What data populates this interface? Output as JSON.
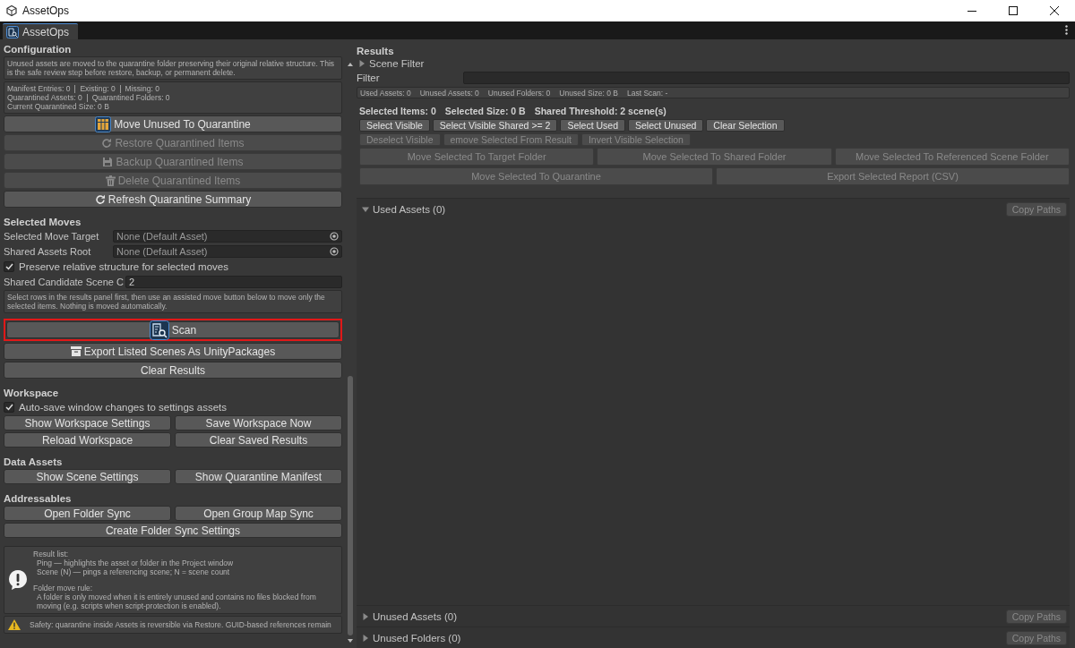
{
  "window": {
    "title": "AssetOps"
  },
  "tabs": [
    {
      "label": "AssetOps",
      "selected": true
    }
  ],
  "configuration": {
    "heading": "Configuration",
    "help": "Unused assets are moved to the quarantine folder preserving their original relative structure. This is the safe review step before restore, backup, or permanent delete.",
    "stats": [
      [
        "Manifest Entries: 0",
        "Existing: 0",
        "Missing: 0"
      ],
      [
        "Quarantined Assets: 0",
        "Quarantined Folders: 0"
      ],
      [
        "Current Quarantined Size: 0 B"
      ]
    ],
    "buttons": [
      {
        "label": "Move Unused To Quarantine",
        "disabled": false
      },
      {
        "label": "Restore Quarantined Items",
        "disabled": true
      },
      {
        "label": "Backup Quarantined Items",
        "disabled": true
      },
      {
        "label": "Delete Quarantined Items",
        "disabled": true
      },
      {
        "label": "Refresh Quarantine Summary",
        "disabled": false
      }
    ]
  },
  "selected_moves": {
    "heading": "Selected Moves",
    "fields": [
      {
        "kind": "object",
        "label": "Selected Move Target",
        "value": "None (Default Asset)"
      },
      {
        "kind": "object",
        "label": "Shared Assets Root",
        "value": "None (Default Asset)"
      },
      {
        "kind": "checkbox",
        "label": "Preserve relative structure for selected moves",
        "checked": true
      },
      {
        "kind": "text",
        "label": "Shared Candidate Scene C",
        "value": "2"
      }
    ],
    "help": "Select rows in the results panel first, then use an assisted move button below to move only the selected items. Nothing is moved automatically.",
    "buttons": [
      {
        "label": "Scan",
        "highlighted": true
      },
      {
        "label": "Export Listed Scenes As UnityPackages",
        "highlighted": false
      },
      {
        "label": "Clear Results",
        "highlighted": false
      }
    ]
  },
  "workspace": {
    "heading": "Workspace",
    "checkbox": {
      "label": "Auto-save window changes to settings assets",
      "checked": true
    },
    "button_rows": [
      [
        "Show Workspace Settings",
        "Save Workspace Now"
      ],
      [
        "Reload Workspace",
        "Clear Saved Results"
      ]
    ]
  },
  "data_assets": {
    "heading": "Data Assets",
    "button_rows": [
      [
        "Show Scene Settings",
        "Show Quarantine Manifest"
      ]
    ]
  },
  "addressables": {
    "heading": "Addressables",
    "button_rows": [
      [
        "Open Folder Sync",
        "Open Group Map Sync"
      ],
      [
        "Create Folder Sync Settings"
      ]
    ]
  },
  "info_box": {
    "paragraphs": [
      {
        "title": "Result list:",
        "lines": [
          "Ping — highlights the asset or folder in the Project window",
          "Scene (N) — pings a referencing scene; N = scene count"
        ]
      },
      {
        "title": "Folder move rule:",
        "lines": [
          "A folder is only moved when it is entirely unused and contains no files blocked from moving (e.g. scripts when script-protection is enabled)."
        ]
      }
    ]
  },
  "warning_box": {
    "text": "Safety: quarantine inside Assets is reversible via Restore. GUID-based references remain"
  },
  "results": {
    "heading": "Results",
    "scene_filter": {
      "label": "Scene Filter",
      "expanded": false
    },
    "filter": {
      "label": "Filter"
    },
    "stats": [
      "Used Assets: 0",
      "Unused Assets: 0",
      "Unused Folders: 0",
      "Unused Size: 0 B",
      "Last Scan: -"
    ],
    "selection_summary": [
      "Selected Items: 0",
      "Selected Size: 0 B",
      "Shared Threshold: 2 scene(s)"
    ],
    "action_rows": [
      {
        "kind": "compact",
        "buttons": [
          {
            "label": "Select Visible",
            "disabled": false
          },
          {
            "label": "Select Visible Shared >= 2",
            "disabled": false
          },
          {
            "label": "Select Used",
            "disabled": false
          },
          {
            "label": "Select Unused",
            "disabled": false
          },
          {
            "label": "Clear Selection",
            "disabled": false
          }
        ]
      },
      {
        "kind": "compact",
        "buttons": [
          {
            "label": "Deselect Visible",
            "disabled": true
          },
          {
            "label": "emove Selected From Result",
            "disabled": true
          },
          {
            "label": "Invert Visible Selection",
            "disabled": true
          }
        ]
      },
      {
        "kind": "stretch",
        "buttons": [
          {
            "label": "Move Selected To Target Folder",
            "disabled": true
          },
          {
            "label": "Move Selected To Shared Folder",
            "disabled": true
          },
          {
            "label": "Move Selected To Referenced Scene Folder",
            "disabled": true
          }
        ]
      },
      {
        "kind": "stretch",
        "buttons": [
          {
            "label": "Move Selected To Quarantine",
            "disabled": true
          },
          {
            "label": "Export Selected Report (CSV)",
            "disabled": true
          }
        ]
      }
    ],
    "groups": [
      {
        "label": "Used Assets (0)",
        "expanded": true,
        "action": {
          "label": "Copy Paths",
          "disabled": true
        }
      },
      {
        "label": "Unused Assets (0)",
        "expanded": false,
        "action": {
          "label": "Copy Paths",
          "disabled": true
        }
      },
      {
        "label": "Unused Folders (0)",
        "expanded": false,
        "action": {
          "label": "Copy Paths",
          "disabled": true
        }
      }
    ]
  }
}
